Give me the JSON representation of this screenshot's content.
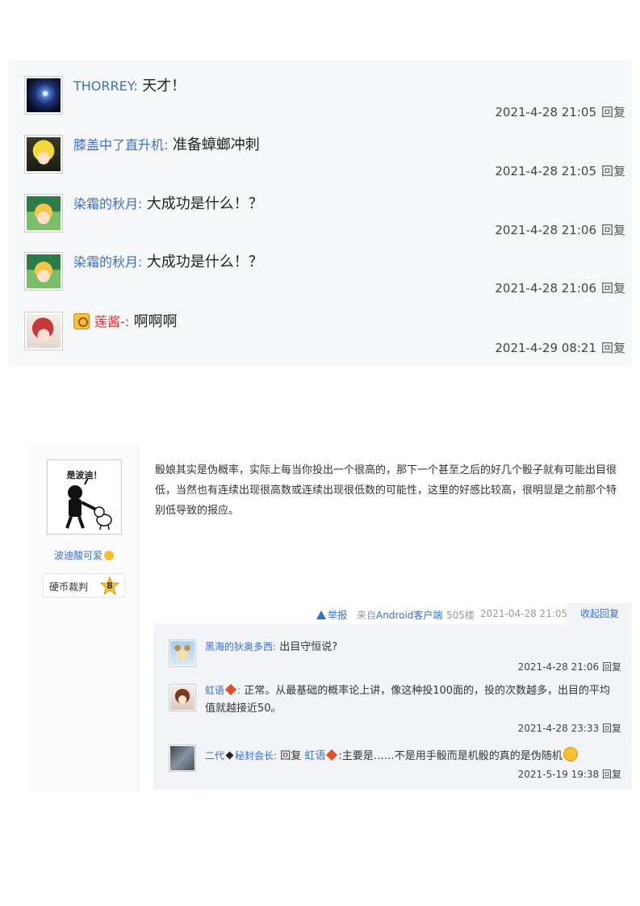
{
  "top_replies": [
    {
      "user": "THORREY",
      "sep": ":",
      "content": "天才！",
      "time": "2021-4-28 21:05",
      "reply_label": "回复",
      "avatar": "space-avatar"
    },
    {
      "user": "膝盖中了直升机",
      "sep": ":",
      "content": "准备蟑螂冲刺",
      "time": "2021-4-28 21:05",
      "reply_label": "回复",
      "avatar": "blonde-anime-avatar"
    },
    {
      "user": "染霜的秋月",
      "sep": ":",
      "content": "大成功是什么！？",
      "time": "2021-4-28 21:06",
      "reply_label": "回复",
      "avatar": "green-anime-avatar"
    },
    {
      "user": "染霜的秋月",
      "sep": ":",
      "content": "大成功是什么！？",
      "time": "2021-4-28 21:06",
      "reply_label": "回复",
      "avatar": "green-anime-avatar"
    },
    {
      "user": "莲酱-",
      "sep": ":",
      "content": "啊啊啊",
      "time": "2021-4-29 08:21",
      "reply_label": "回复",
      "avatar": "red-hair-avatar",
      "badge_icon": "member-badge-icon"
    }
  ],
  "post": {
    "avatar_caption": "是波迪！",
    "author": "波迪酸可爱",
    "author_icon": "smile-icon",
    "level_label": "硬币裁判",
    "level_number": "8",
    "body": "骰娘其实是伪概率，实际上每当你投出一个很高的，那下一个甚至之后的好几个骰子就有可能出目很低，当然也有连续出现很高数或连续出现很低数的可能性，这里的好感比较高，很明显是之前那个特别低导致的报应。",
    "report_label": "举报",
    "client_prefix": "来自",
    "client_link": "Android客户端",
    "floor": "505楼",
    "time": "2021-04-28 21:05",
    "collapse_label": "收起回复"
  },
  "sub_replies": [
    {
      "user": "黑海的狄奥多西",
      "sep": ":",
      "content": "出目守恒说?",
      "time": "2021-4-28 21:06",
      "reply_label": "回复",
      "avatar": "bear-avatar"
    },
    {
      "user": "虹语",
      "sep": ":",
      "content": "正常。从最基础的概率论上讲，像这种投100面的，投的次数越多，出目的平均值就越接近50。",
      "time": "2021-4-28 23:33",
      "reply_label": "回复",
      "avatar": "girl-avatar"
    },
    {
      "user_a": "二代",
      "user_b": "秘封会长",
      "sep": ":",
      "reply_word": "回复",
      "target": "虹语",
      "content": ":主要是……不是用手骰而是机骰的真的是伪随机",
      "time": "2021-5-19 19:38",
      "reply_label": "回复",
      "avatar": "gray-avatar"
    }
  ]
}
